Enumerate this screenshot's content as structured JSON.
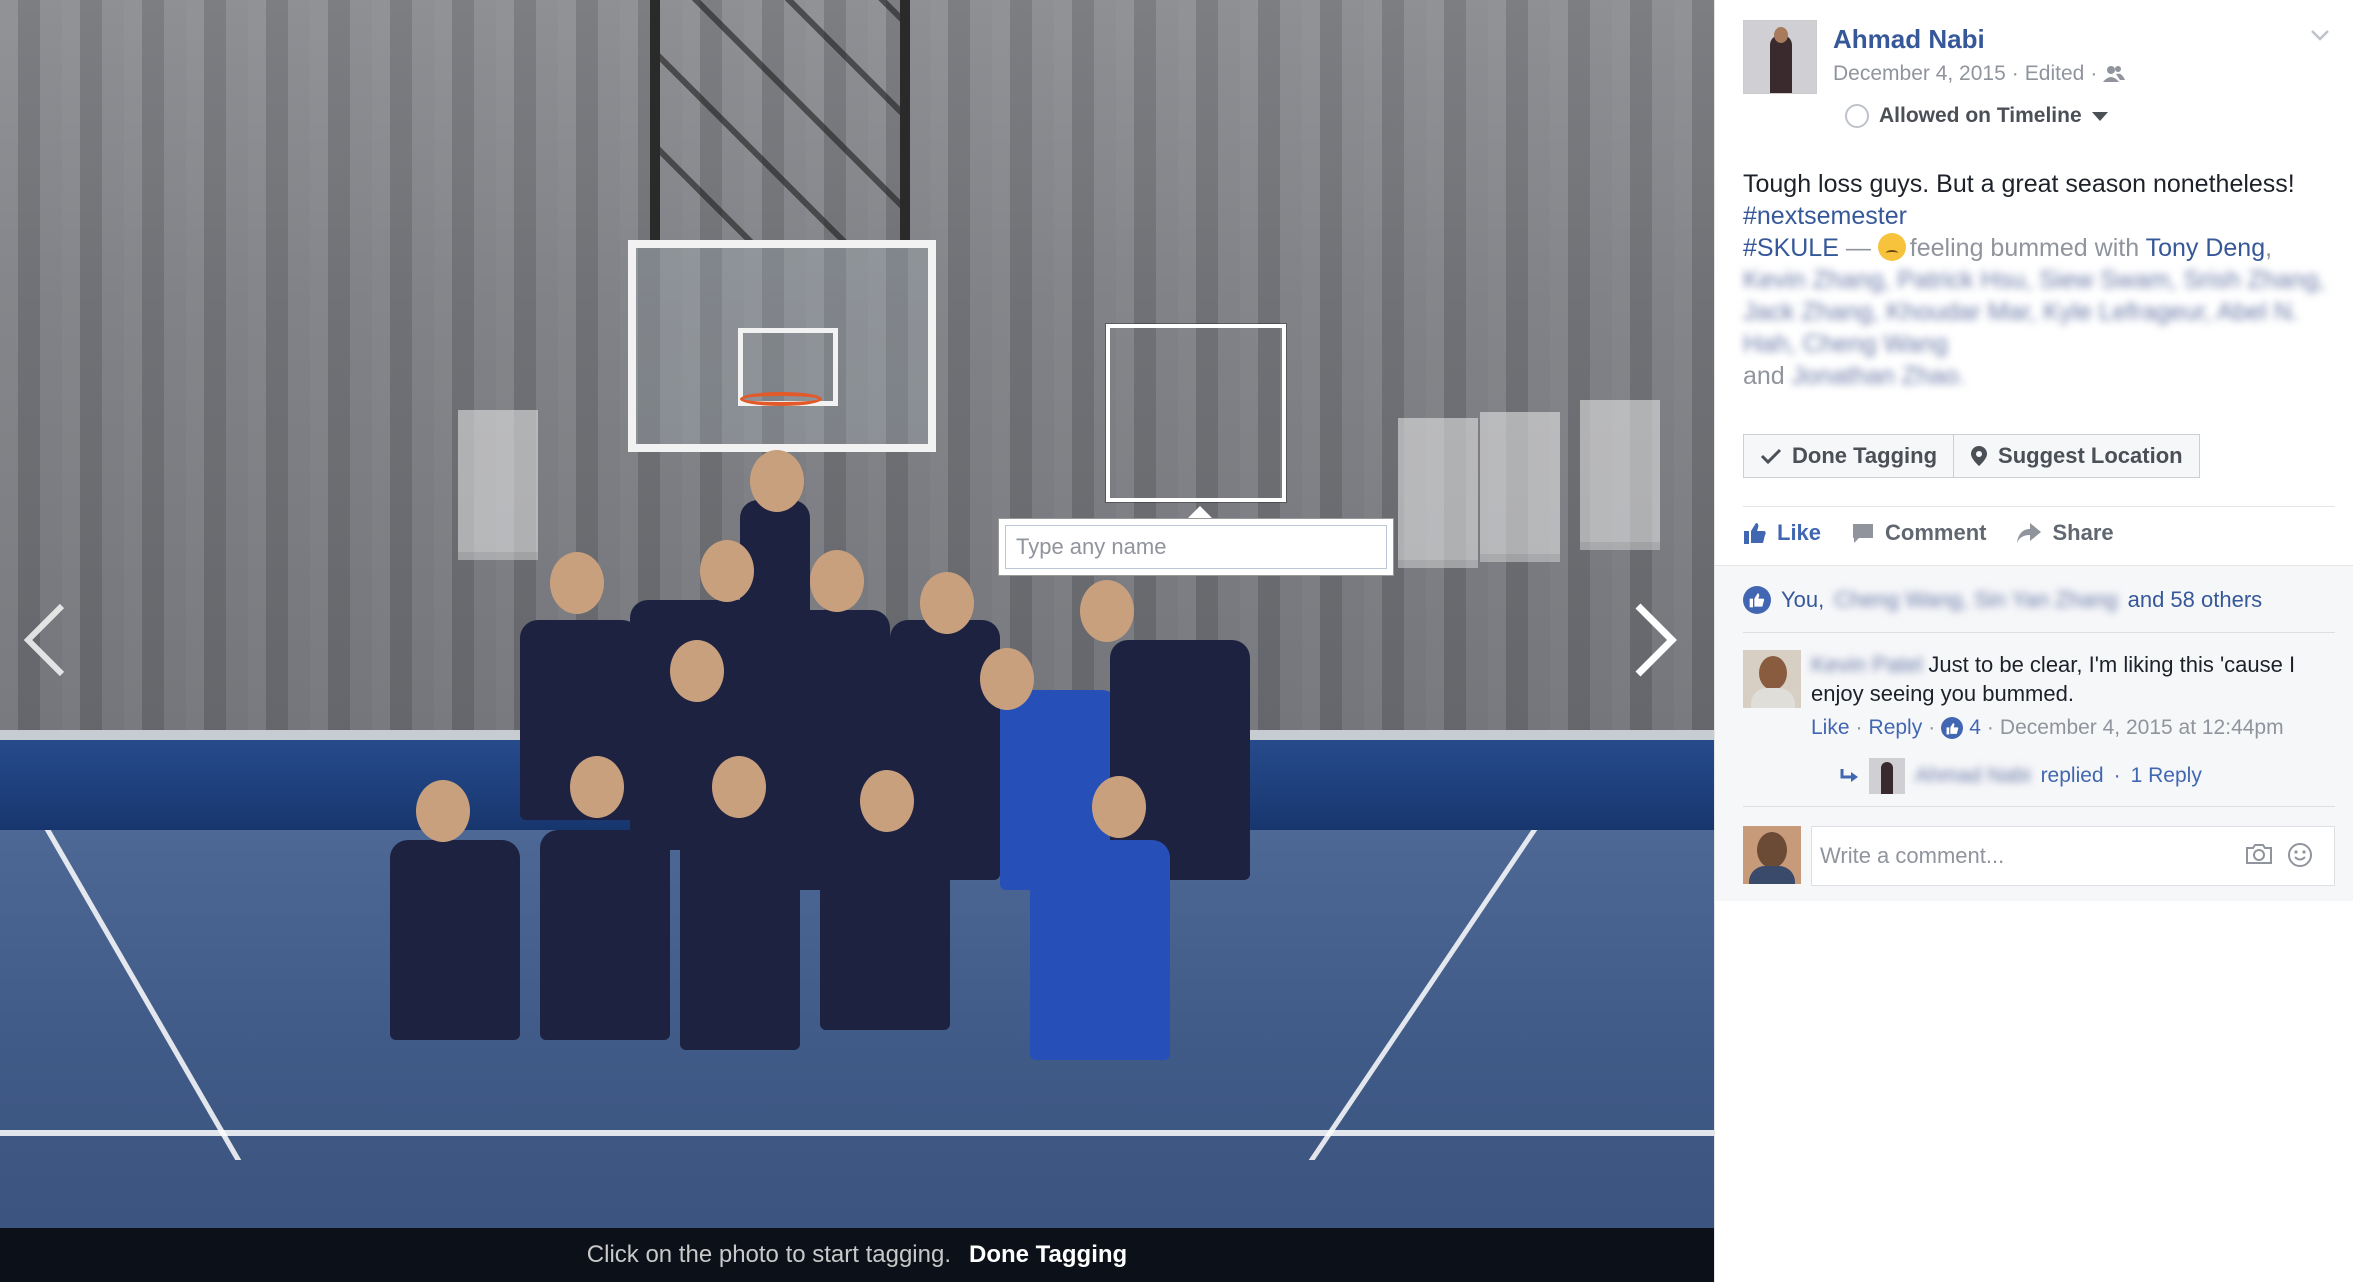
{
  "viewer": {
    "prev_label": "Previous",
    "next_label": "Next",
    "tagging_hint": "Click on the photo to start tagging.",
    "tagging_done": "Done Tagging",
    "tag_input_placeholder": "Type any name"
  },
  "post": {
    "author": "Ahmad Nabi",
    "date": "December 4, 2015",
    "edited": "Edited",
    "privacy_icon": "friends-icon",
    "timeline_status": "Allowed on Timeline",
    "text_line1": "Tough loss guys. But a great season nonetheless!",
    "hashtag1": "#nextsemester",
    "hashtag2": "#SKULE",
    "feeling_prefix": " — ",
    "feeling": "feeling bummed",
    "with_word": " with ",
    "tagged_first": "Tony Deng",
    "tagged_rest_blurred": "Kevin Zhang, Patrick Hsu, Siew Swam, Srish Zhang, Jack Zhang, Khoudar Mar, Kyle Lefrageur, Abel N. Hah, Cheng Wang",
    "tagged_and": "and",
    "tagged_last_blurred": "Jonathan Zhao."
  },
  "buttons": {
    "done_tagging": "Done Tagging",
    "suggest_location": "Suggest Location"
  },
  "actions": {
    "like": "Like",
    "comment": "Comment",
    "share": "Share"
  },
  "reactions": {
    "prefix": "You,",
    "blurred_names": "Cheng Wang, Sin Yan Zhang",
    "suffix": "and 58 others"
  },
  "comment": {
    "author_blurred": "Kevin Patel",
    "text": "Just to be clear, I'm liking this 'cause I enjoy seeing you bummed.",
    "like": "Like",
    "reply": "Reply",
    "like_count": "4",
    "timestamp": "December 4, 2015 at 12:44pm",
    "reply_author_blurred": "Ahmad Nabi",
    "replied": "replied",
    "reply_count": "1 Reply"
  },
  "composer": {
    "placeholder": "Write a comment..."
  },
  "colors": {
    "link": "#365899",
    "accent": "#4267b2",
    "muted": "#90949c"
  }
}
